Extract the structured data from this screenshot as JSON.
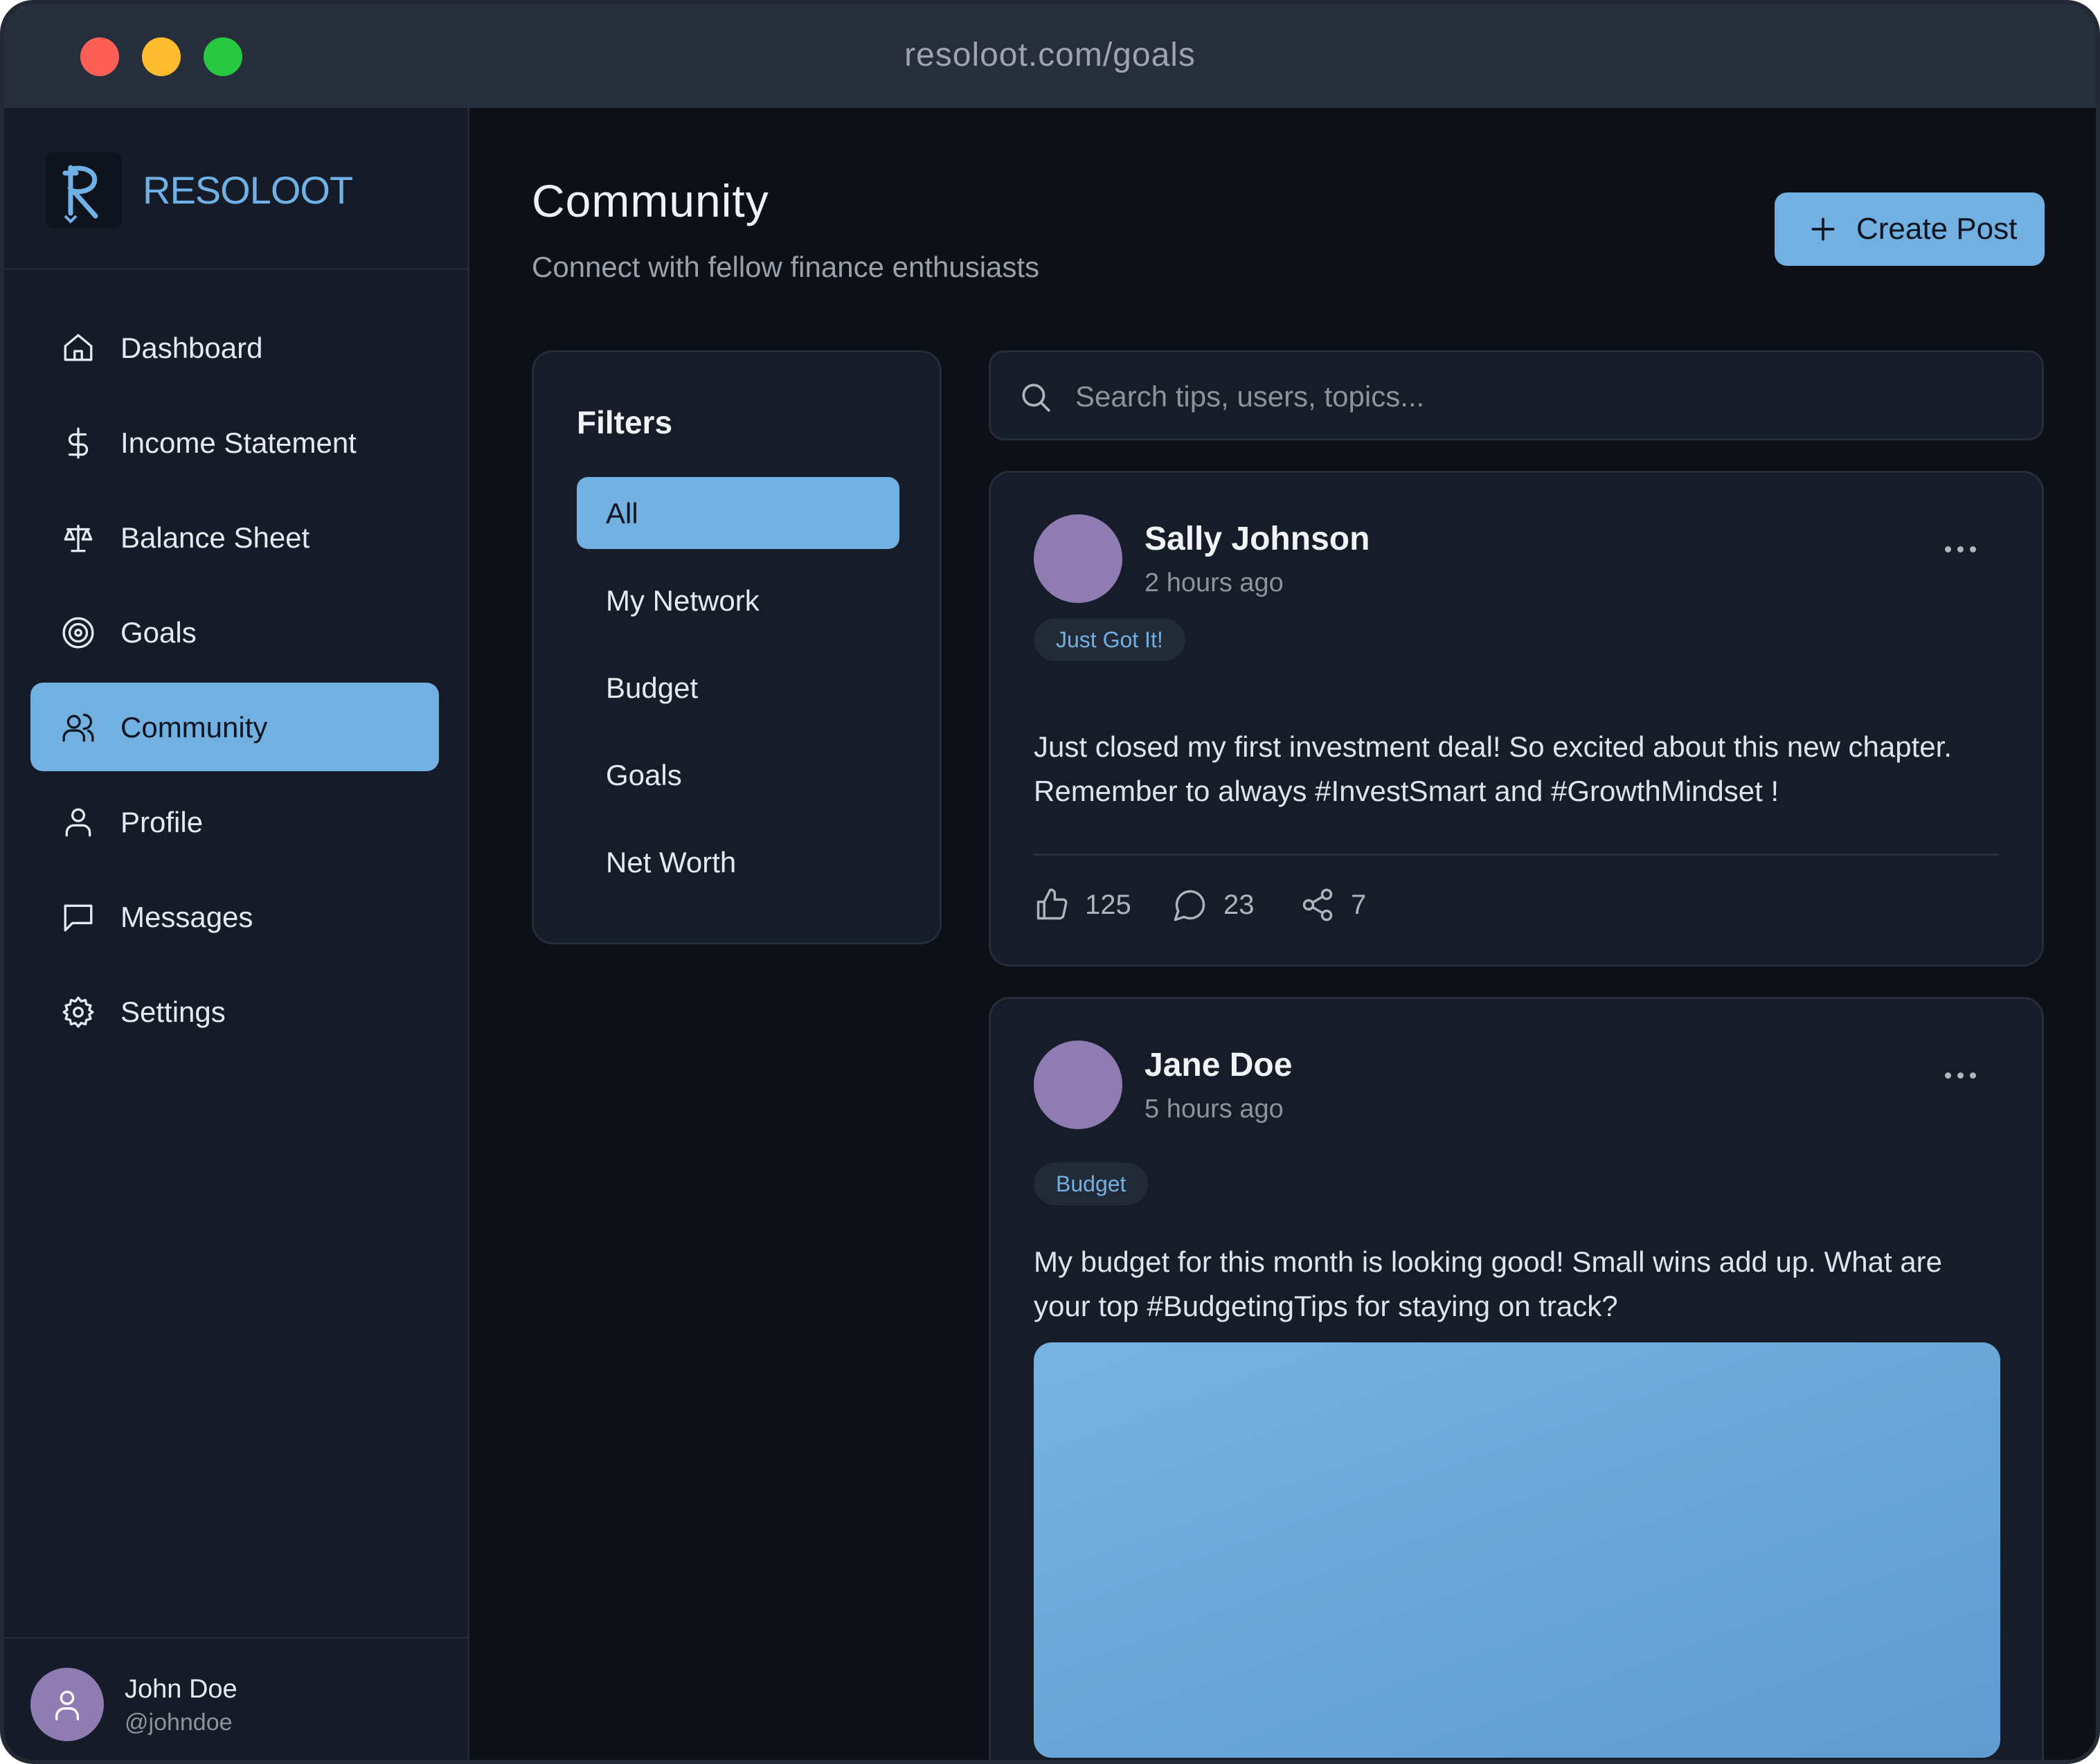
{
  "browser": {
    "url": "resoloot.com/goals"
  },
  "sidebar": {
    "brand": "RESOLOOT",
    "items": [
      {
        "label": "Dashboard",
        "icon": "home-icon"
      },
      {
        "label": "Income Statement",
        "icon": "dollar-icon"
      },
      {
        "label": "Balance Sheet",
        "icon": "scale-icon"
      },
      {
        "label": "Goals",
        "icon": "target-icon"
      },
      {
        "label": "Community",
        "icon": "users-icon",
        "active": true
      },
      {
        "label": "Profile",
        "icon": "user-icon"
      },
      {
        "label": "Messages",
        "icon": "message-icon"
      },
      {
        "label": "Settings",
        "icon": "gear-icon"
      }
    ],
    "user": {
      "name": "John Doe",
      "handle": "@johndoe"
    }
  },
  "header": {
    "title": "Community",
    "subtitle": "Connect with fellow finance enthusiasts",
    "create_label": "Create Post"
  },
  "filters": {
    "title": "Filters",
    "items": [
      "All",
      "My Network",
      "Budget",
      "Goals",
      "Net Worth"
    ],
    "active": "All"
  },
  "search": {
    "placeholder": "Search tips, users, topics..."
  },
  "posts": [
    {
      "author": "Sally Johnson",
      "time": "2 hours ago",
      "tag": "Just Got It!",
      "body": "Just closed my first investment deal! So excited about this new chapter. Remember to always #InvestSmart and #GrowthMindset !",
      "likes": "125",
      "comments": "23",
      "shares": "7"
    },
    {
      "author": "Jane Doe",
      "time": "5 hours ago",
      "tag": "Budget",
      "body": "My budget for this month is looking good! Small wins add up. What are your top #BudgetingTips for staying on track?"
    }
  ],
  "colors": {
    "accent": "#72b0e2",
    "background": "#0d1117",
    "panel": "#171d28",
    "avatar": "#8e7cb3"
  }
}
